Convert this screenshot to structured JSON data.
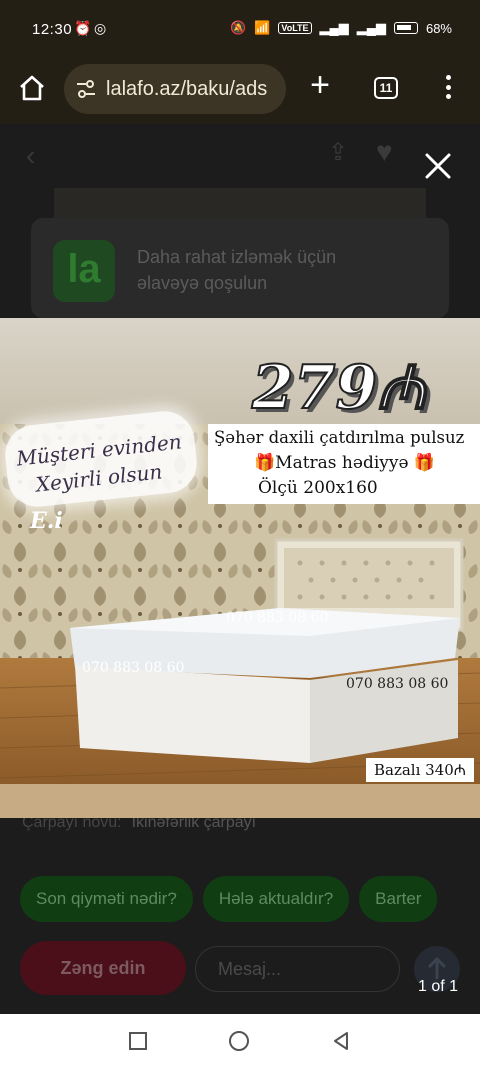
{
  "status_bar": {
    "time": "12:30",
    "volte": "VoLTE",
    "battery_percent": "68%"
  },
  "browser": {
    "url": "lalafo.az/baku/ads",
    "tab_count": "11"
  },
  "app_banner": {
    "logo_letters": "la",
    "line1": "Daha rahat izləmək üçün",
    "line2": "əlavəyə qoşulun"
  },
  "listing_image": {
    "price": "279₼",
    "caption_line1": "Müşteri evinden",
    "caption_line2": "Xeyirli olsun",
    "watermark": "E.i",
    "info_line1": "Şəhər daxili çatdırılma pulsuz",
    "info_line2": "🎁Matras hədiyyə 🎁",
    "info_line3": "Ölçü 200x160",
    "phone_1": "070 883 08 60",
    "phone_2": "070 883 08 60",
    "phone_3": "070 883 08 60",
    "base_price": "Bazalı 340₼"
  },
  "spec": {
    "label": "Çarpayı növü:",
    "value": "Ikinəfərlik çarpayı"
  },
  "quick_replies": [
    "Son qiyməti nədir?",
    "Hələ aktualdır?",
    "Barter"
  ],
  "actions": {
    "call_label": "Zəng edin",
    "message_placeholder": "Mesaj..."
  },
  "viewer": {
    "counter": "1 of 1"
  },
  "colors": {
    "brand_green": "#2e7d32",
    "call_red": "#c8102e",
    "browser_chrome": "#241f15"
  }
}
